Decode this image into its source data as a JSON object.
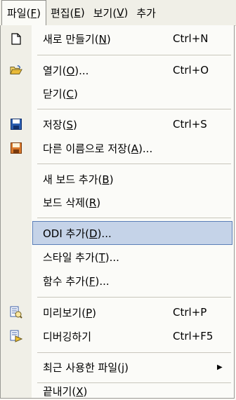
{
  "menubar": {
    "items": [
      {
        "text": "파일(",
        "key": "F",
        "tail": ")"
      },
      {
        "text": "편집(",
        "key": "E",
        "tail": ")"
      },
      {
        "text": "보기(",
        "key": "V",
        "tail": ")"
      },
      {
        "text": "추가",
        "key": "",
        "tail": ""
      }
    ]
  },
  "menu": {
    "new": {
      "pre": "새로 만들기(",
      "key": "N",
      "post": ")",
      "shortcut": "Ctrl+N"
    },
    "open": {
      "pre": "열기(",
      "key": "O",
      "post": ")...",
      "shortcut": "Ctrl+O"
    },
    "close": {
      "pre": "닫기(",
      "key": "C",
      "post": ")"
    },
    "save": {
      "pre": "저장(",
      "key": "S",
      "post": ")",
      "shortcut": "Ctrl+S"
    },
    "save_as": {
      "pre": "다른 이름으로 저장(",
      "key": "A",
      "post": ")..."
    },
    "add_board": {
      "pre": "새 보드 추가(",
      "key": "B",
      "post": ")"
    },
    "del_board": {
      "pre": "보드 삭제(",
      "key": "R",
      "post": ")"
    },
    "add_odi": {
      "pre": "ODI 추가(",
      "key": "D",
      "post": ")..."
    },
    "add_style": {
      "pre": "스타일 추가(",
      "key": "T",
      "post": ")..."
    },
    "add_func": {
      "pre": "함수 추가(",
      "key": "F",
      "post": ")..."
    },
    "preview": {
      "pre": "미리보기(",
      "key": "P",
      "post": ")",
      "shortcut": "Ctrl+P"
    },
    "debug": {
      "pre": "디버깅하기",
      "shortcut": "Ctrl+F5"
    },
    "recent": {
      "pre": "최근 사용한 파일(",
      "key": "j",
      "post": ")"
    },
    "exit": {
      "pre": "끝내기(",
      "key": "X",
      "post": ")"
    }
  },
  "icons": {
    "new": "new-document-icon",
    "open": "open-folder-icon",
    "save": "save-disk-icon",
    "save_as": "save-as-disk-icon",
    "preview": "preview-icon",
    "debug": "debug-icon",
    "submenu": "submenu-arrow-icon"
  },
  "colors": {
    "highlight": "#c5d3e8",
    "highlight_border": "#5b7fb8",
    "save_blue": "#2a5db0",
    "save_orange": "#d9782b"
  }
}
